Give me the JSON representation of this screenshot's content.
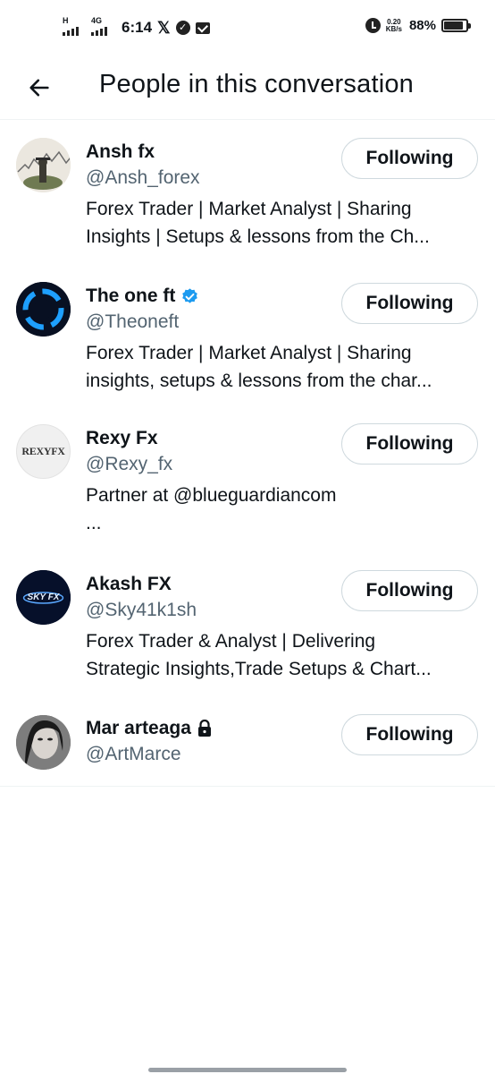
{
  "status_bar": {
    "network_tag_1": "H",
    "network_tag_2": "4G",
    "time": "6:14",
    "speed_value": "0.20",
    "speed_unit": "KB/s",
    "battery": "88%",
    "battery_level": 0.88,
    "icons": [
      "signal-icon",
      "signal-icon",
      "x-logo-icon",
      "circle-icon",
      "mail-icon",
      "alarm-icon",
      "battery-icon"
    ]
  },
  "header": {
    "back_icon": "arrow-left-icon",
    "title": "People in this conversation"
  },
  "users": [
    {
      "name": "Ansh fx",
      "handle": "@Ansh_forex",
      "bio": "Forex Trader | Market Analyst | Sharing\nInsights | Setups & lessons from the Ch...",
      "button": "Following"
    },
    {
      "name": "The one ft",
      "handle": "@Theoneft",
      "bio": "Forex Trader | Market Analyst | Sharing\ninsights, setups & lessons from the char...",
      "button": "Following",
      "badge": "verified-icon"
    },
    {
      "name": "Rexy Fx",
      "handle": "@Rexy_fx",
      "bio": "Partner at @blueguardiancom\n...",
      "button": "Following",
      "avatar_text": "REXYFX"
    },
    {
      "name": "Akash FX",
      "handle": "@Sky41k1sh",
      "bio": "Forex Trader & Analyst | Delivering\nStrategic Insights,Trade Setups & Chart...",
      "button": "Following",
      "avatar_text": "SKY FX"
    },
    {
      "name": "Mar arteaga",
      "handle": "@ArtMarce",
      "bio": "",
      "button": "Following",
      "badge": "lock-icon"
    }
  ],
  "colors": {
    "text": "#0f1419",
    "secondary": "#536471",
    "border": "#cfd9de",
    "verified": "#1d9bf0"
  }
}
